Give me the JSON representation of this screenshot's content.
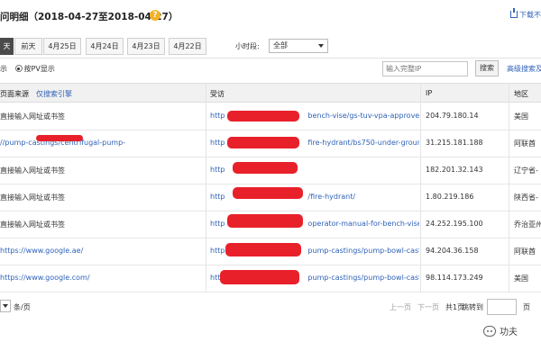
{
  "header": {
    "title": "问明细（2018-04-27至2018-04-27）",
    "help_icon": "question-circle-icon",
    "download_label": "下载不",
    "download_icon": "download-icon"
  },
  "tabs": [
    "天",
    "前天",
    "4月25日",
    "4月24日",
    "4月23日",
    "4月22日"
  ],
  "active_tab": 0,
  "hour_filter": {
    "label": "小时段:",
    "value": "全部"
  },
  "display_options": {
    "first_label": "示",
    "second_label": "按PV显示",
    "selected": 1
  },
  "search": {
    "placeholder": "输入完整IP",
    "button_label": "搜索",
    "advanced_label": "高级搜索及"
  },
  "table": {
    "col_source": "页面来源",
    "col_source_link": "仅搜索引擎",
    "col_visit": "受访",
    "col_ip": "IP",
    "col_region": "地区",
    "rows": [
      {
        "source": "直接输入网址或书签",
        "source_is_link": false,
        "visit_prefix": "http",
        "visit_suffix": "bench-vise/gs-tuv-vpa-approved-",
        "ip": "204.79.180.14",
        "region": "美国"
      },
      {
        "source": "//pump-castings/centrifugal-pump-",
        "source_is_link": true,
        "visit_prefix": "http",
        "visit_suffix": "fire-hydrant/bs750-under-ground-",
        "ip": "31.215.181.188",
        "region": "阿联酋"
      },
      {
        "source": "直接输入网址或书签",
        "source_is_link": false,
        "visit_prefix": "http",
        "visit_suffix": "",
        "ip": "182.201.32.143",
        "region": "辽宁省-"
      },
      {
        "source": "直接输入网址或书签",
        "source_is_link": false,
        "visit_prefix": "http",
        "visit_suffix": "/fire-hydrant/",
        "ip": "1.80.219.186",
        "region": "陕西省-"
      },
      {
        "source": "直接输入网址或书签",
        "source_is_link": false,
        "visit_prefix": "http",
        "visit_suffix": "operator-manual-for-bench-vise-",
        "ip": "24.252.195.100",
        "region": "乔治亚州"
      },
      {
        "source": "https://www.google.ae/",
        "source_is_link": true,
        "visit_prefix": "http",
        "visit_suffix": "pump-castings/pump-bowl-castin",
        "ip": "94.204.36.158",
        "region": "阿联酋"
      },
      {
        "source": "https://www.google.com/",
        "source_is_link": true,
        "visit_prefix": "http",
        "visit_suffix": "pump-castings/pump-bowl-castin",
        "ip": "98.114.173.249",
        "region": "美国"
      }
    ]
  },
  "pagination": {
    "per_page_label": "条/页",
    "prev_label": "上一页",
    "next_label": "下一页",
    "summary": "共1页",
    "goto_label": "跳转到",
    "page_unit": "页"
  },
  "watermark": {
    "text": "功夫"
  },
  "colors": {
    "redaction": "#e8202a",
    "link": "#2f62b8",
    "active_tab": "#4b4b4b"
  }
}
